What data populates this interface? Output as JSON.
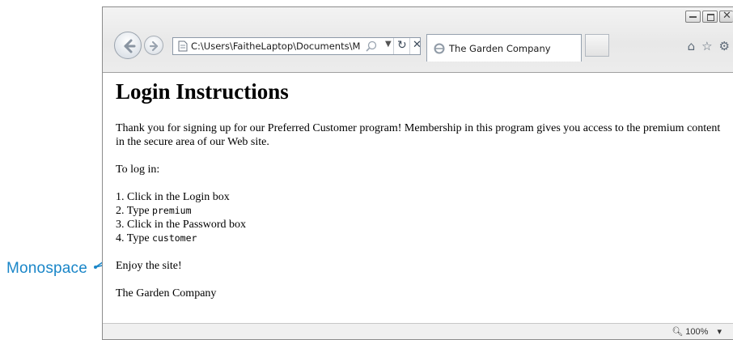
{
  "callout": {
    "label": "Monospace"
  },
  "browser": {
    "address": "C:\\Users\\FaitheLaptop\\Documents\\M",
    "tab_title": "The Garden Company",
    "zoom": "100%",
    "icons": {
      "home": "home-icon",
      "favorites": "star-icon",
      "tools": "gear-icon"
    }
  },
  "page": {
    "heading": "Login Instructions",
    "intro": "Thank you for signing up for our Preferred Customer program! Membership in this program gives you access to the premium content in the secure area of our Web site.",
    "login_intro": "To log in:",
    "steps": [
      {
        "prefix": "1. Click in the Login box",
        "code": ""
      },
      {
        "prefix": "2. Type ",
        "code": "premium"
      },
      {
        "prefix": "3. Click in the Password box",
        "code": ""
      },
      {
        "prefix": "4. Type ",
        "code": "customer"
      }
    ],
    "enjoy": "Enjoy the site!",
    "signature": "The Garden Company"
  }
}
